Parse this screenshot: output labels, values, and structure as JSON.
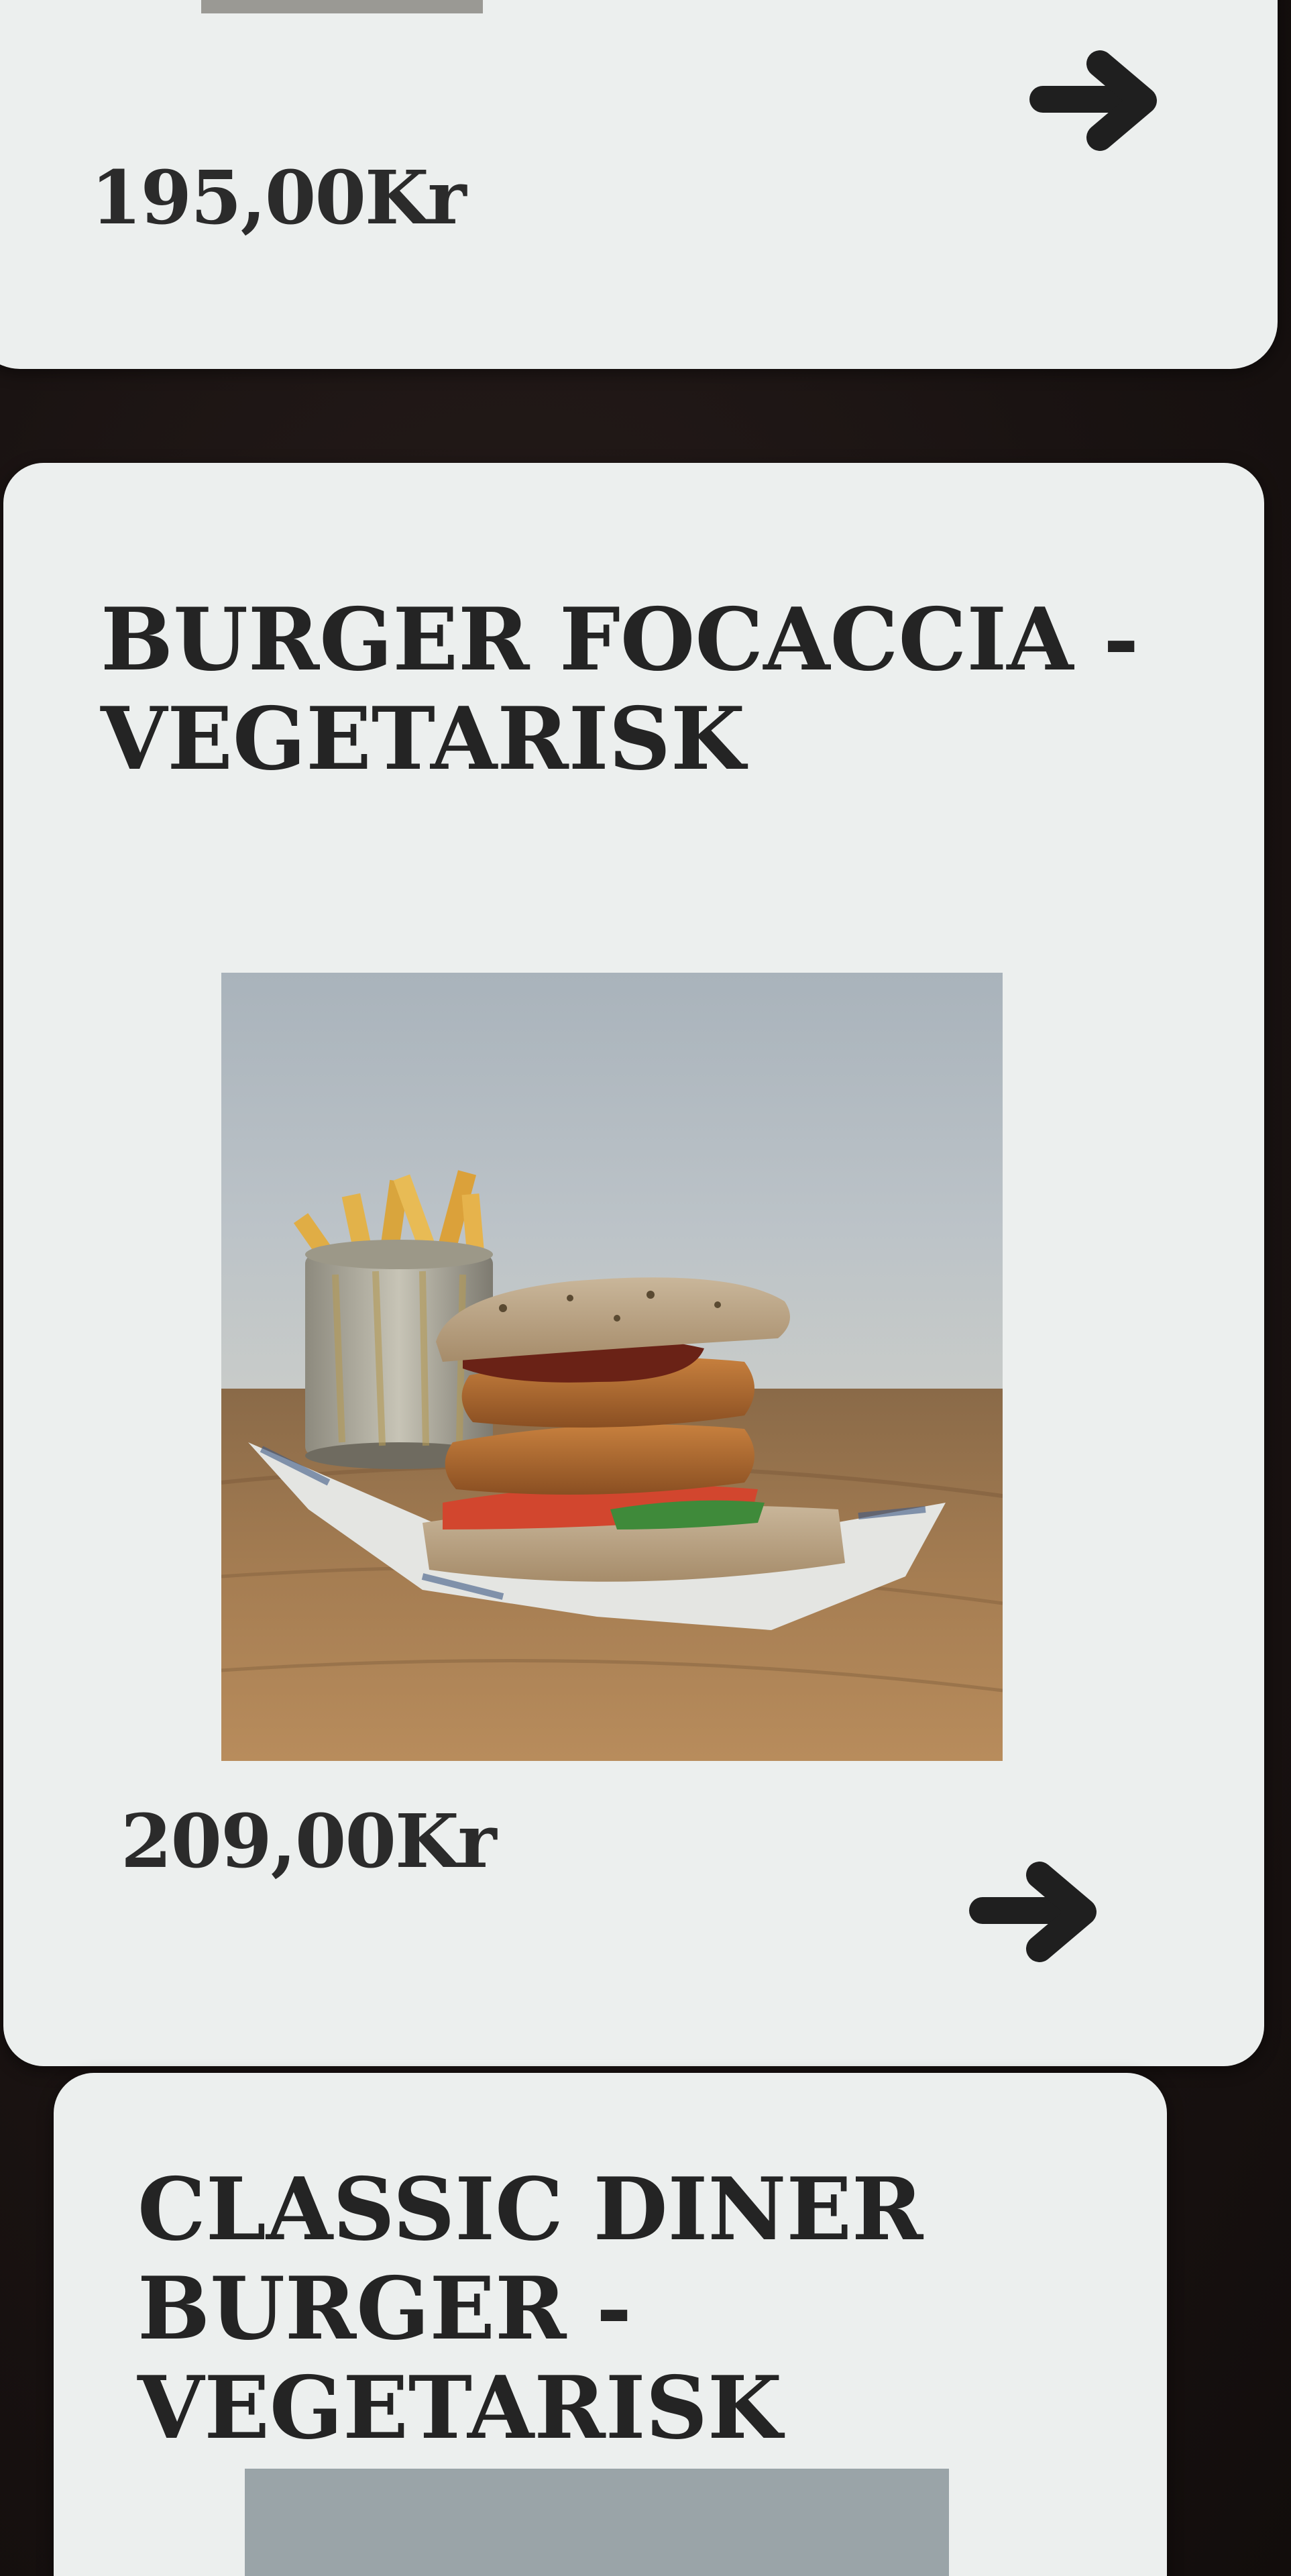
{
  "cards": [
    {
      "price": "195,00Kr",
      "arrow_icon": "arrow-right-icon"
    },
    {
      "title": "BURGER FOCACCIA -\nVEGETARISK",
      "image_alt": "Burger focaccia with fries",
      "price": "209,00Kr",
      "arrow_icon": "arrow-right-icon"
    },
    {
      "title": "CLASSIC DINER\nBURGER -\nVEGETARISK"
    }
  ],
  "colors": {
    "card_bg": "#ecefee",
    "screen_bg": "#1c1514",
    "text": "#242424"
  }
}
